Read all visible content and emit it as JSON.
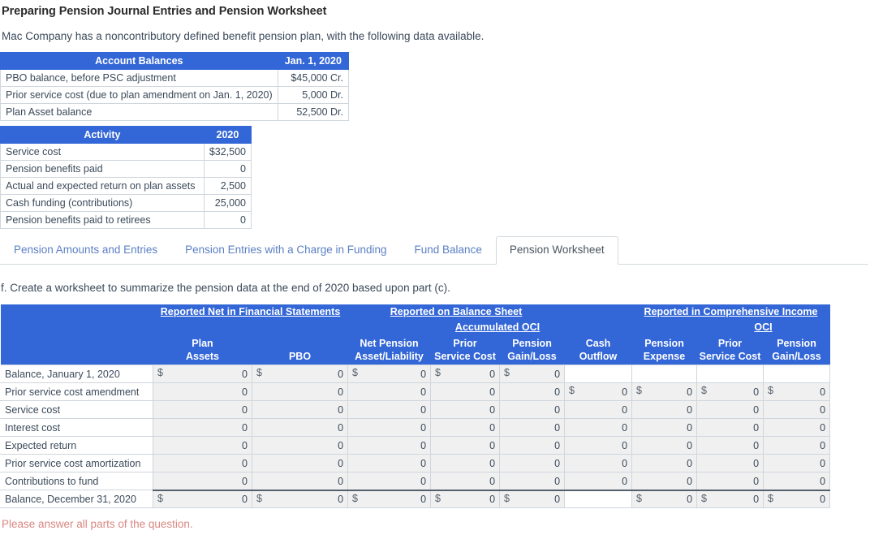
{
  "title": "Preparing Pension Journal Entries and Pension Worksheet",
  "intro": "Mac Company has a noncontributory defined benefit pension plan, with the following data available.",
  "account_balances": {
    "headers": [
      "Account Balances",
      "Jan. 1, 2020"
    ],
    "rows": [
      [
        "PBO balance, before PSC adjustment",
        "$45,000 Cr."
      ],
      [
        "Prior service cost (due to plan amendment on Jan. 1, 2020)",
        "5,000 Dr."
      ],
      [
        "Plan Asset balance",
        "52,500 Dr."
      ]
    ]
  },
  "activity": {
    "headers": [
      "Activity",
      "2020"
    ],
    "rows": [
      [
        "Service cost",
        "$32,500"
      ],
      [
        "Pension benefits paid",
        "0"
      ],
      [
        "Actual and expected return on plan assets",
        "2,500"
      ],
      [
        "Cash funding (contributions)",
        "25,000"
      ],
      [
        "Pension benefits paid to retirees",
        "0"
      ]
    ]
  },
  "tabs": [
    {
      "label": "Pension Amounts and Entries",
      "active": false
    },
    {
      "label": "Pension Entries with a Charge in Funding",
      "active": false
    },
    {
      "label": "Fund Balance",
      "active": false
    },
    {
      "label": "Pension Worksheet",
      "active": true
    }
  ],
  "part_f": "f. Create a worksheet to summarize the pension data at the end of 2020 based upon part (c).",
  "worksheet": {
    "group_headers": [
      "Reported Net in Financial Statements",
      "Reported on Balance Sheet",
      "Reported in Comprehensive Income"
    ],
    "sub_headers": {
      "balance_sheet": "Accumulated OCI",
      "comprehensive_income": "OCI"
    },
    "columns": [
      "Plan\nAssets",
      "PBO",
      "Net Pension\nAsset/Liability",
      "Prior\nService Cost",
      "Pension\nGain/Loss",
      "Cash\nOutflow",
      "Pension\nExpense",
      "Prior\nService Cost",
      "Pension\nGain/Loss"
    ],
    "columns_flat": {
      "plan_assets_l1": "Plan",
      "plan_assets_l2": "Assets",
      "pbo_l1": "",
      "pbo_l2": "PBO",
      "net_pension_l1": "Net Pension",
      "net_pension_l2": "Asset/Liability",
      "aoci_psc_l1": "Prior",
      "aoci_psc_l2": "Service Cost",
      "aoci_gl_l1": "Pension",
      "aoci_gl_l2": "Gain/Loss",
      "cash_l1": "Cash",
      "cash_l2": "Outflow",
      "exp_l1": "Pension",
      "exp_l2": "Expense",
      "oci_psc_l1": "Prior",
      "oci_psc_l2": "Service Cost",
      "oci_gl_l1": "Pension",
      "oci_gl_l2": "Gain/Loss"
    },
    "rows": [
      {
        "label": "Balance, January 1, 2020",
        "total": false,
        "cells": [
          {
            "dollar": "$",
            "value": "0"
          },
          {
            "dollar": "$",
            "value": "0"
          },
          {
            "dollar": "$",
            "value": "0"
          },
          {
            "dollar": "$",
            "value": "0"
          },
          {
            "dollar": "$",
            "value": "0"
          },
          {
            "blank": true
          },
          {
            "blank": true
          },
          {
            "blank": true
          },
          {
            "blank": true
          }
        ]
      },
      {
        "label": "Prior service cost amendment",
        "total": false,
        "cells": [
          {
            "dollar": "",
            "value": "0"
          },
          {
            "dollar": "",
            "value": "0"
          },
          {
            "dollar": "",
            "value": "0"
          },
          {
            "dollar": "",
            "value": "0"
          },
          {
            "dollar": "",
            "value": "0"
          },
          {
            "dollar": "$",
            "value": "0"
          },
          {
            "dollar": "$",
            "value": "0"
          },
          {
            "dollar": "$",
            "value": "0"
          },
          {
            "dollar": "$",
            "value": "0"
          }
        ]
      },
      {
        "label": "Service cost",
        "total": false,
        "cells": [
          {
            "dollar": "",
            "value": "0"
          },
          {
            "dollar": "",
            "value": "0"
          },
          {
            "dollar": "",
            "value": "0"
          },
          {
            "dollar": "",
            "value": "0"
          },
          {
            "dollar": "",
            "value": "0"
          },
          {
            "dollar": "",
            "value": "0"
          },
          {
            "dollar": "",
            "value": "0"
          },
          {
            "dollar": "",
            "value": "0"
          },
          {
            "dollar": "",
            "value": "0"
          }
        ]
      },
      {
        "label": "Interest cost",
        "total": false,
        "cells": [
          {
            "dollar": "",
            "value": "0"
          },
          {
            "dollar": "",
            "value": "0"
          },
          {
            "dollar": "",
            "value": "0"
          },
          {
            "dollar": "",
            "value": "0"
          },
          {
            "dollar": "",
            "value": "0"
          },
          {
            "dollar": "",
            "value": "0"
          },
          {
            "dollar": "",
            "value": "0"
          },
          {
            "dollar": "",
            "value": "0"
          },
          {
            "dollar": "",
            "value": "0"
          }
        ]
      },
      {
        "label": "Expected return",
        "total": false,
        "cells": [
          {
            "dollar": "",
            "value": "0"
          },
          {
            "dollar": "",
            "value": "0"
          },
          {
            "dollar": "",
            "value": "0"
          },
          {
            "dollar": "",
            "value": "0"
          },
          {
            "dollar": "",
            "value": "0"
          },
          {
            "dollar": "",
            "value": "0"
          },
          {
            "dollar": "",
            "value": "0"
          },
          {
            "dollar": "",
            "value": "0"
          },
          {
            "dollar": "",
            "value": "0"
          }
        ]
      },
      {
        "label": "Prior service cost amortization",
        "total": false,
        "cells": [
          {
            "dollar": "",
            "value": "0"
          },
          {
            "dollar": "",
            "value": "0"
          },
          {
            "dollar": "",
            "value": "0"
          },
          {
            "dollar": "",
            "value": "0"
          },
          {
            "dollar": "",
            "value": "0"
          },
          {
            "dollar": "",
            "value": "0"
          },
          {
            "dollar": "",
            "value": "0"
          },
          {
            "dollar": "",
            "value": "0"
          },
          {
            "dollar": "",
            "value": "0"
          }
        ]
      },
      {
        "label": "Contributions to fund",
        "total": false,
        "cells": [
          {
            "dollar": "",
            "value": "0"
          },
          {
            "dollar": "",
            "value": "0"
          },
          {
            "dollar": "",
            "value": "0"
          },
          {
            "dollar": "",
            "value": "0"
          },
          {
            "dollar": "",
            "value": "0"
          },
          {
            "dollar": "",
            "value": "0"
          },
          {
            "dollar": "",
            "value": "0"
          },
          {
            "dollar": "",
            "value": "0"
          },
          {
            "dollar": "",
            "value": "0"
          }
        ]
      },
      {
        "label": "Balance, December 31, 2020",
        "total": true,
        "cells": [
          {
            "dollar": "$",
            "value": "0"
          },
          {
            "dollar": "$",
            "value": "0"
          },
          {
            "dollar": "$",
            "value": "0"
          },
          {
            "dollar": "$",
            "value": "0"
          },
          {
            "dollar": "$",
            "value": "0"
          },
          {
            "blank": true
          },
          {
            "dollar": "$",
            "value": "0"
          },
          {
            "dollar": "$",
            "value": "0"
          },
          {
            "dollar": "$",
            "value": "0"
          }
        ]
      }
    ]
  },
  "footer_message": "Please answer all parts of the question.",
  "colors": {
    "header_blue": "#3366d6",
    "tab_link": "#5b7fc4",
    "error_text": "#d98781",
    "body_text": "#3b4a5a",
    "cell_bg": "#f0f0f0"
  }
}
